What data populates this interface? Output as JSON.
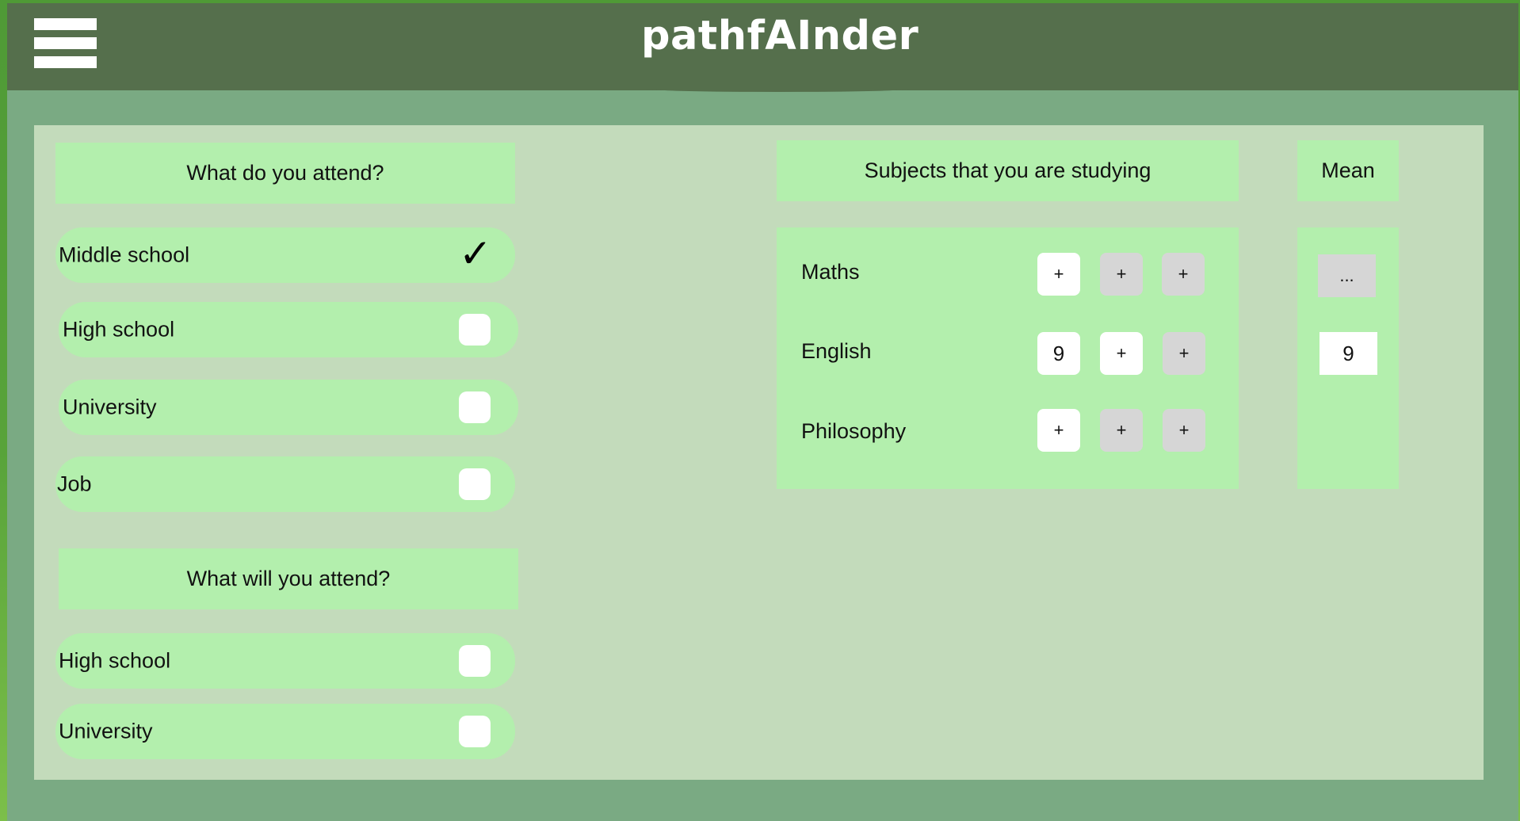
{
  "app": {
    "title": "pathfAInder",
    "menu_icon": "hamburger-menu-icon"
  },
  "attend_now": {
    "heading": "What do you attend?",
    "options": [
      {
        "label": "Middle school",
        "checked": true
      },
      {
        "label": "High school",
        "checked": false
      },
      {
        "label": "University",
        "checked": false
      },
      {
        "label": "Job",
        "checked": false
      }
    ]
  },
  "attend_future": {
    "heading": "What will you attend?",
    "options": [
      {
        "label": "High school",
        "checked": false
      },
      {
        "label": "University",
        "checked": false
      }
    ]
  },
  "subjects": {
    "heading": "Subjects that you are studying",
    "rows": [
      {
        "name": "Maths",
        "grades": [
          "+",
          "+",
          "+"
        ]
      },
      {
        "name": "English",
        "grades": [
          "9",
          "+",
          "+"
        ]
      },
      {
        "name": "Philosophy",
        "grades": [
          "+",
          "+",
          "+"
        ]
      }
    ]
  },
  "mean": {
    "heading": "Mean",
    "values": [
      "...",
      "9"
    ]
  },
  "colors": {
    "topbar": "#556f4c",
    "background": "#7aaa83",
    "panel": "#c3dbbb",
    "pill": "#b3efad",
    "button_grey": "#d6d6d6",
    "button_white": "#ffffff"
  }
}
